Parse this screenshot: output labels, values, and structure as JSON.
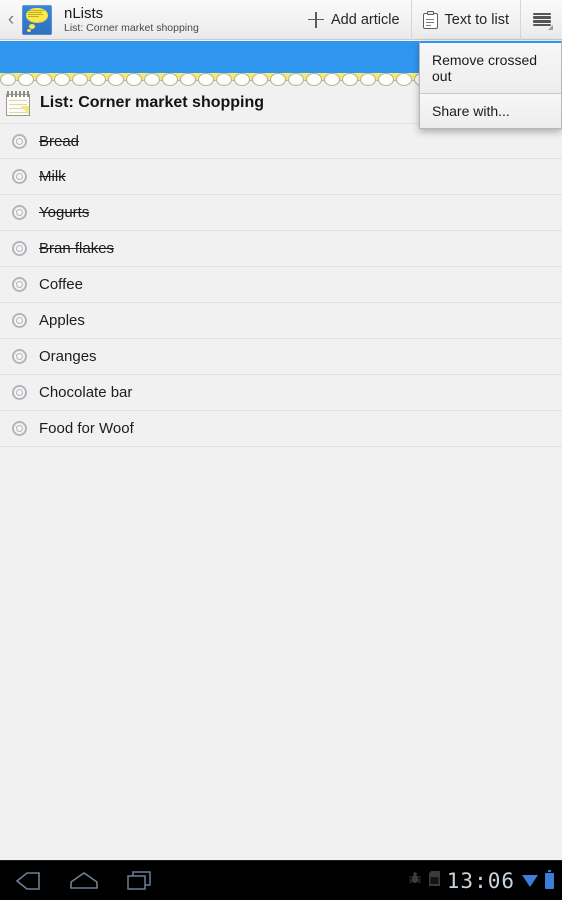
{
  "actionbar": {
    "back_icon": "back-chevron-icon",
    "app_icon": "nlists-thought-bubble-icon",
    "title": "nLists",
    "subtitle": "List: Corner market shopping",
    "actions": [
      {
        "label": "Add article",
        "icon": "plus-icon"
      },
      {
        "label": "Text to list",
        "icon": "clipboard-icon"
      }
    ],
    "overflow_icon": "hamburger-menu-icon"
  },
  "decor": {
    "blue_band_color": "#2f96f0",
    "yellow_band_color": "#f2e95e",
    "spiral_ring_count": 32
  },
  "list_header": {
    "icon": "notepad-icon",
    "text": "List: Corner market shopping"
  },
  "items": [
    {
      "label": "Bread",
      "done": true
    },
    {
      "label": "Milk",
      "done": true
    },
    {
      "label": "Yogurts",
      "done": true
    },
    {
      "label": "Bran flakes",
      "done": true
    },
    {
      "label": "Coffee",
      "done": false
    },
    {
      "label": "Apples",
      "done": false
    },
    {
      "label": "Oranges",
      "done": false
    },
    {
      "label": "Chocolate bar",
      "done": false
    },
    {
      "label": "Food for Woof",
      "done": false
    }
  ],
  "overflow_menu": {
    "visible": true,
    "items": [
      {
        "label": "Remove crossed out"
      },
      {
        "label": "Share with..."
      }
    ]
  },
  "navbar": {
    "back_icon": "android-back-icon",
    "home_icon": "android-home-icon",
    "recents_icon": "android-recents-icon",
    "status": {
      "debug_icon": "usb-debug-bug-icon",
      "storage_icon": "sd-card-icon",
      "clock": "13:06",
      "wifi_icon": "wifi-signal-icon",
      "battery_icon": "battery-icon"
    }
  }
}
